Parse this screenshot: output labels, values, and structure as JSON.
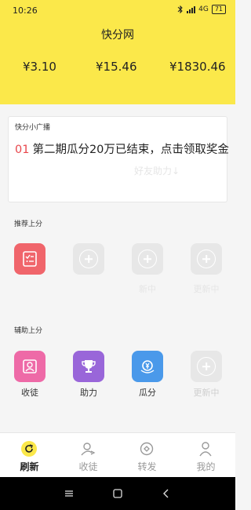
{
  "status_bar": {
    "time": "10:26",
    "network": "4G",
    "battery": "71"
  },
  "app": {
    "title": "快分网"
  },
  "stats": [
    "¥3.10",
    "¥15.46",
    "¥1830.46"
  ],
  "broadcast": {
    "title": "快分小广播",
    "index": "01",
    "message": "第二期瓜分20万已结束，点击领取奖金",
    "faint_text": "好友助力↓"
  },
  "recommend": {
    "label": "推荐上分",
    "items": [
      {
        "label": "",
        "icon": "task-list-icon",
        "color": "#f0656b"
      },
      {
        "label": "",
        "icon": "plus-icon",
        "color": "#e7e7e7"
      },
      {
        "label": "新中",
        "icon": "plus-icon",
        "color": "#e7e7e7"
      },
      {
        "label": "更新中",
        "icon": "plus-icon",
        "color": "#e7e7e7"
      }
    ]
  },
  "assist": {
    "label": "辅助上分",
    "items": [
      {
        "label": "收徒",
        "icon": "apprentice-icon",
        "color": "#ee6aa7"
      },
      {
        "label": "助力",
        "icon": "trophy-icon",
        "color": "#9966d9"
      },
      {
        "label": "瓜分",
        "icon": "coin-split-icon",
        "color": "#4a99ea"
      },
      {
        "label": "更新中",
        "icon": "plus-icon",
        "color": "#e7e7e7"
      }
    ]
  },
  "nav": [
    {
      "label": "刷新",
      "icon": "refresh-icon",
      "active": true
    },
    {
      "label": "收徒",
      "icon": "add-person-icon",
      "active": false
    },
    {
      "label": "转发",
      "icon": "share-icon",
      "active": false
    },
    {
      "label": "我的",
      "icon": "profile-icon",
      "active": false
    }
  ],
  "accent": "#fbe84a"
}
